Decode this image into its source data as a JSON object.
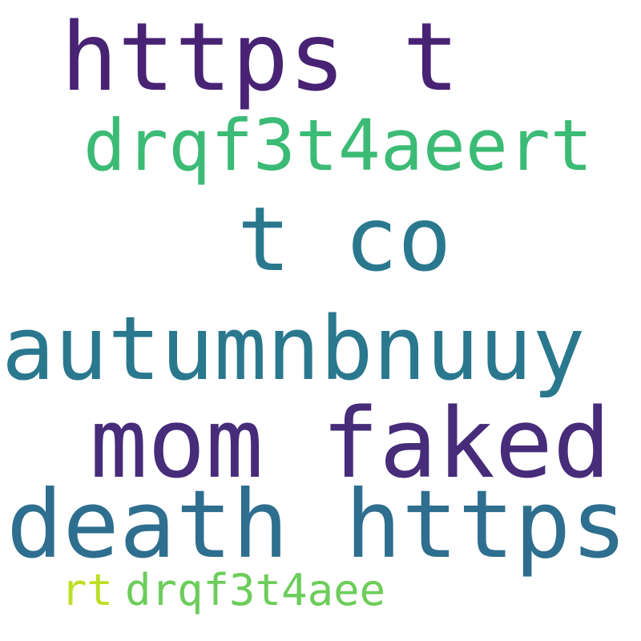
{
  "background": "#ffffff",
  "words": [
    {
      "text": "https t",
      "color": "#482374"
    },
    {
      "text": "drqf3t4aeert",
      "color": "#3bbb75"
    },
    {
      "text": "t co",
      "color": "#2a788e"
    },
    {
      "text": "autumnbnuuy",
      "color": "#2a788e"
    },
    {
      "text": "mom faked",
      "color": "#472c7a"
    },
    {
      "text": "death https",
      "color": "#2e6e8e"
    },
    {
      "text": "rt",
      "color": "#bddf26"
    },
    {
      "text": "drqf3t4aee",
      "color": "#6ccd5a"
    }
  ]
}
